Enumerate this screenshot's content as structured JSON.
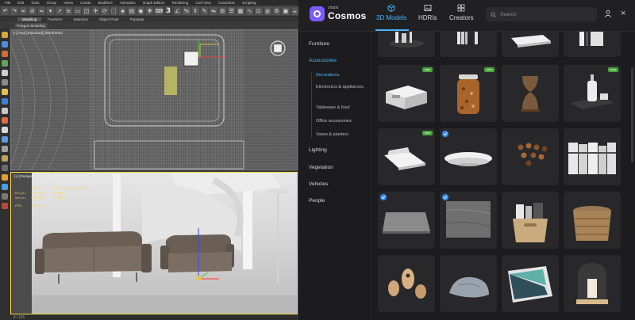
{
  "max": {
    "menu": [
      "File",
      "Edit",
      "Tools",
      "Group",
      "Views",
      "Create",
      "Modifiers",
      "Animation",
      "Graph Editors",
      "Rendering",
      "Civil View",
      "Customize",
      "Scripting"
    ],
    "toolbar_num": "3",
    "ribbon_tabs": [
      "Modeling",
      "Freeform",
      "Selection",
      "Object Paint",
      "Populate"
    ],
    "sub_label": "Polygon Modeling",
    "top_viewport_label": "[+] [Top] [Standard] [Wireframe]",
    "persp_viewport_label": "[+] [Perspective] [Standard] [Default Shading]",
    "stats": {
      "headers": [
        "Total",
        "Dear Lounge 400_002"
      ],
      "rows": [
        [
          "Polys:",
          "195,364",
          "3,906"
        ],
        [
          "Verts:",
          "98,238",
          "1,972"
        ]
      ],
      "fps_label": "FPS:",
      "fps_value": "Inactive"
    },
    "status_text": "0 / 225"
  },
  "cosmos": {
    "brand_small": "chaos",
    "brand": "Cosmos",
    "tabs": [
      {
        "label": "3D Models",
        "icon": "cube-icon",
        "active": true
      },
      {
        "label": "HDRIs",
        "icon": "image-icon",
        "active": false
      },
      {
        "label": "Creators",
        "icon": "grid-icon",
        "active": false
      }
    ],
    "search_placeholder": "Search",
    "sidebar": {
      "categories": [
        "Furniture",
        "Accessories",
        "Lighting",
        "Vegetation",
        "Vehicles",
        "People"
      ],
      "accessories_sub": [
        "Decorations",
        "Electronics & appliances",
        "Tableware & food",
        "Office accessories",
        "Vases & planters"
      ]
    },
    "badge_new": "new",
    "accent": "#4db3ff",
    "brand_color": "#7b5cff"
  }
}
